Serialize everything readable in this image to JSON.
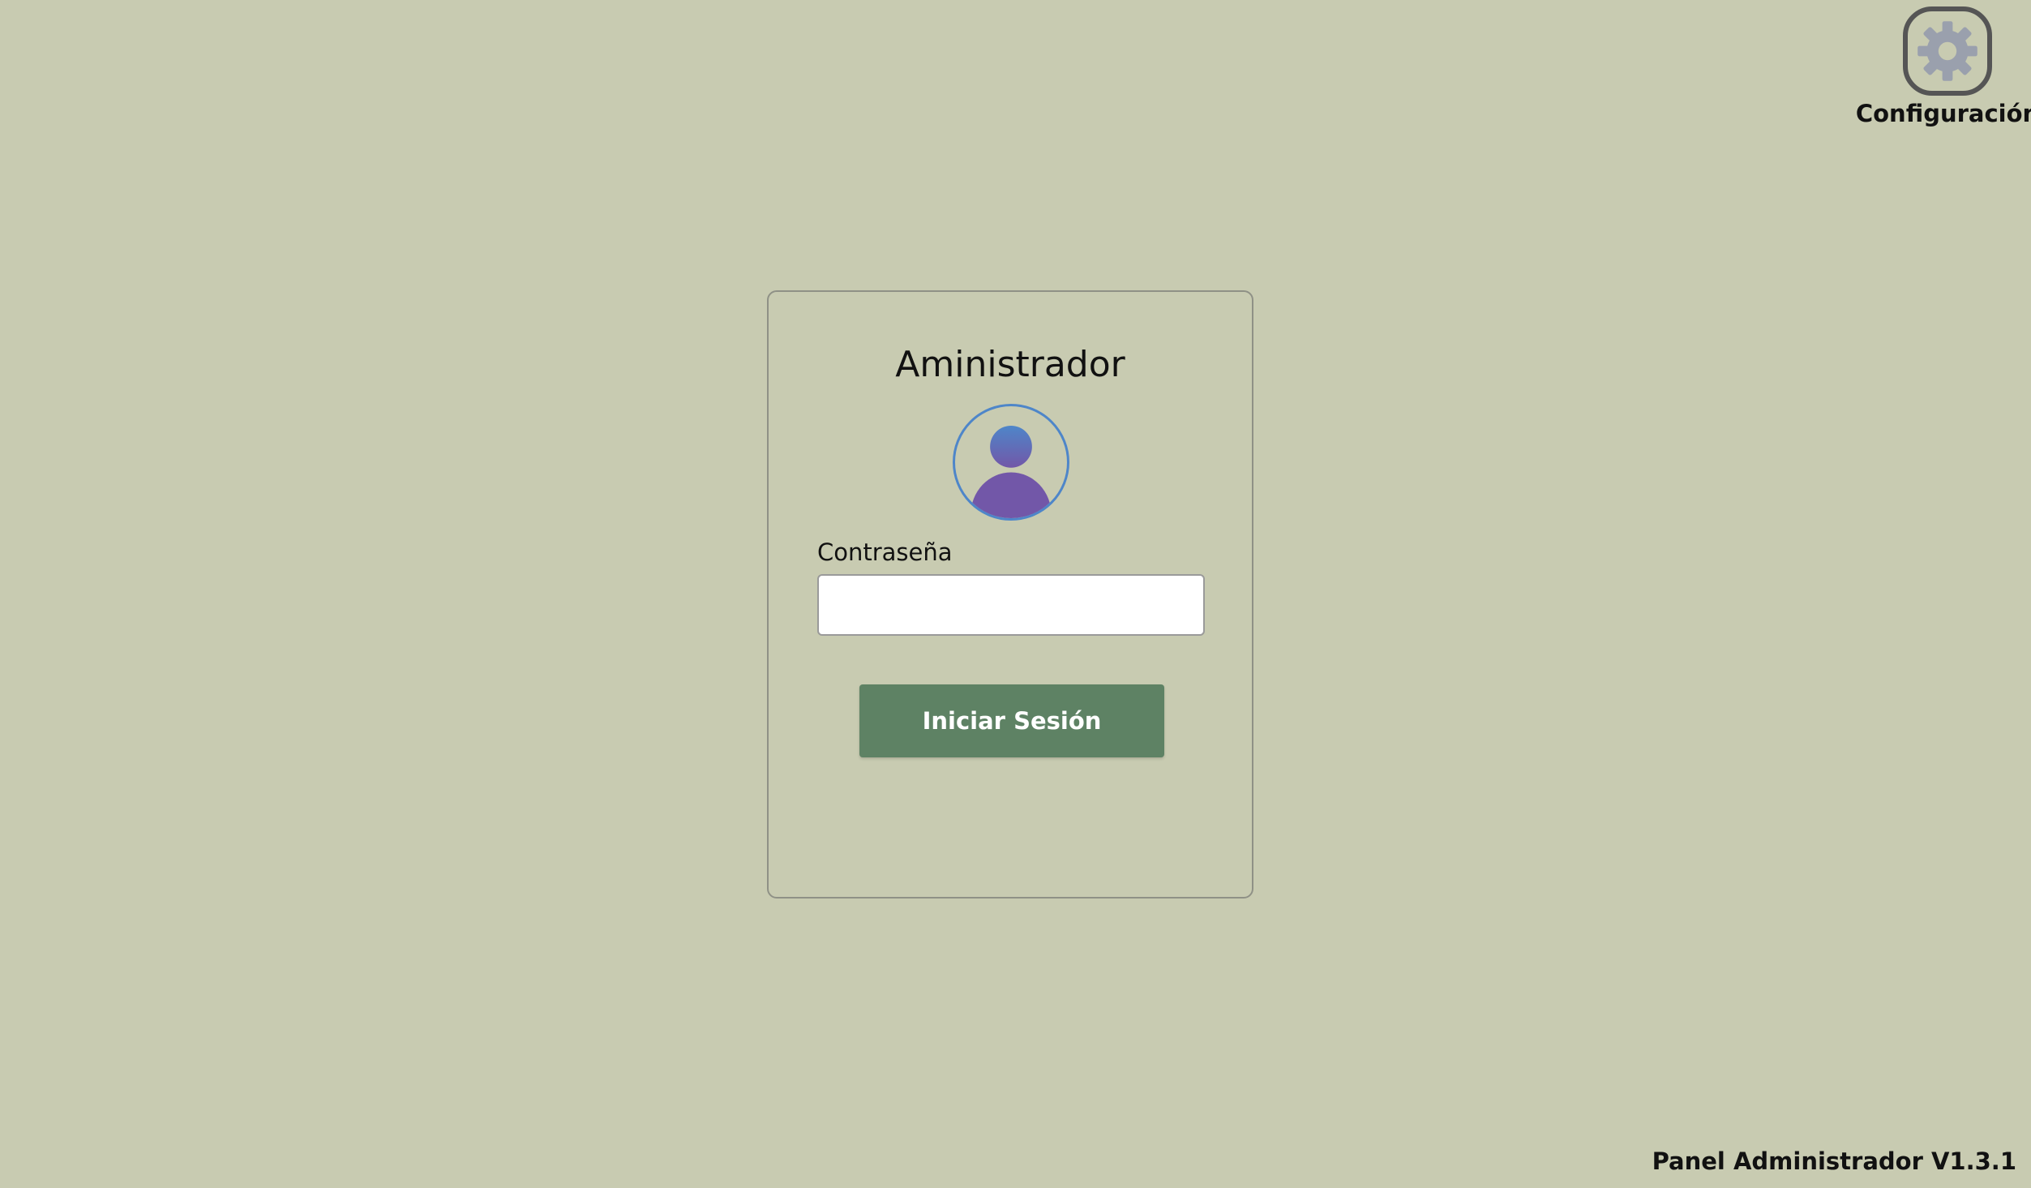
{
  "settings": {
    "label": "Configuración",
    "icon": "gear-icon"
  },
  "login": {
    "title": "Aministrador",
    "avatar_icon": "user-avatar-icon",
    "password_label": "Contraseña",
    "password_value": "",
    "password_placeholder": "",
    "submit_label": "Iniciar Sesión"
  },
  "footer": {
    "version": "Panel Administrador V1.3.1"
  },
  "colors": {
    "background": "#c8cbb1",
    "button": "#5e8264",
    "avatar_head": "#4e86c9",
    "avatar_body": "#7257a8",
    "gear": "#9aa0ad"
  }
}
